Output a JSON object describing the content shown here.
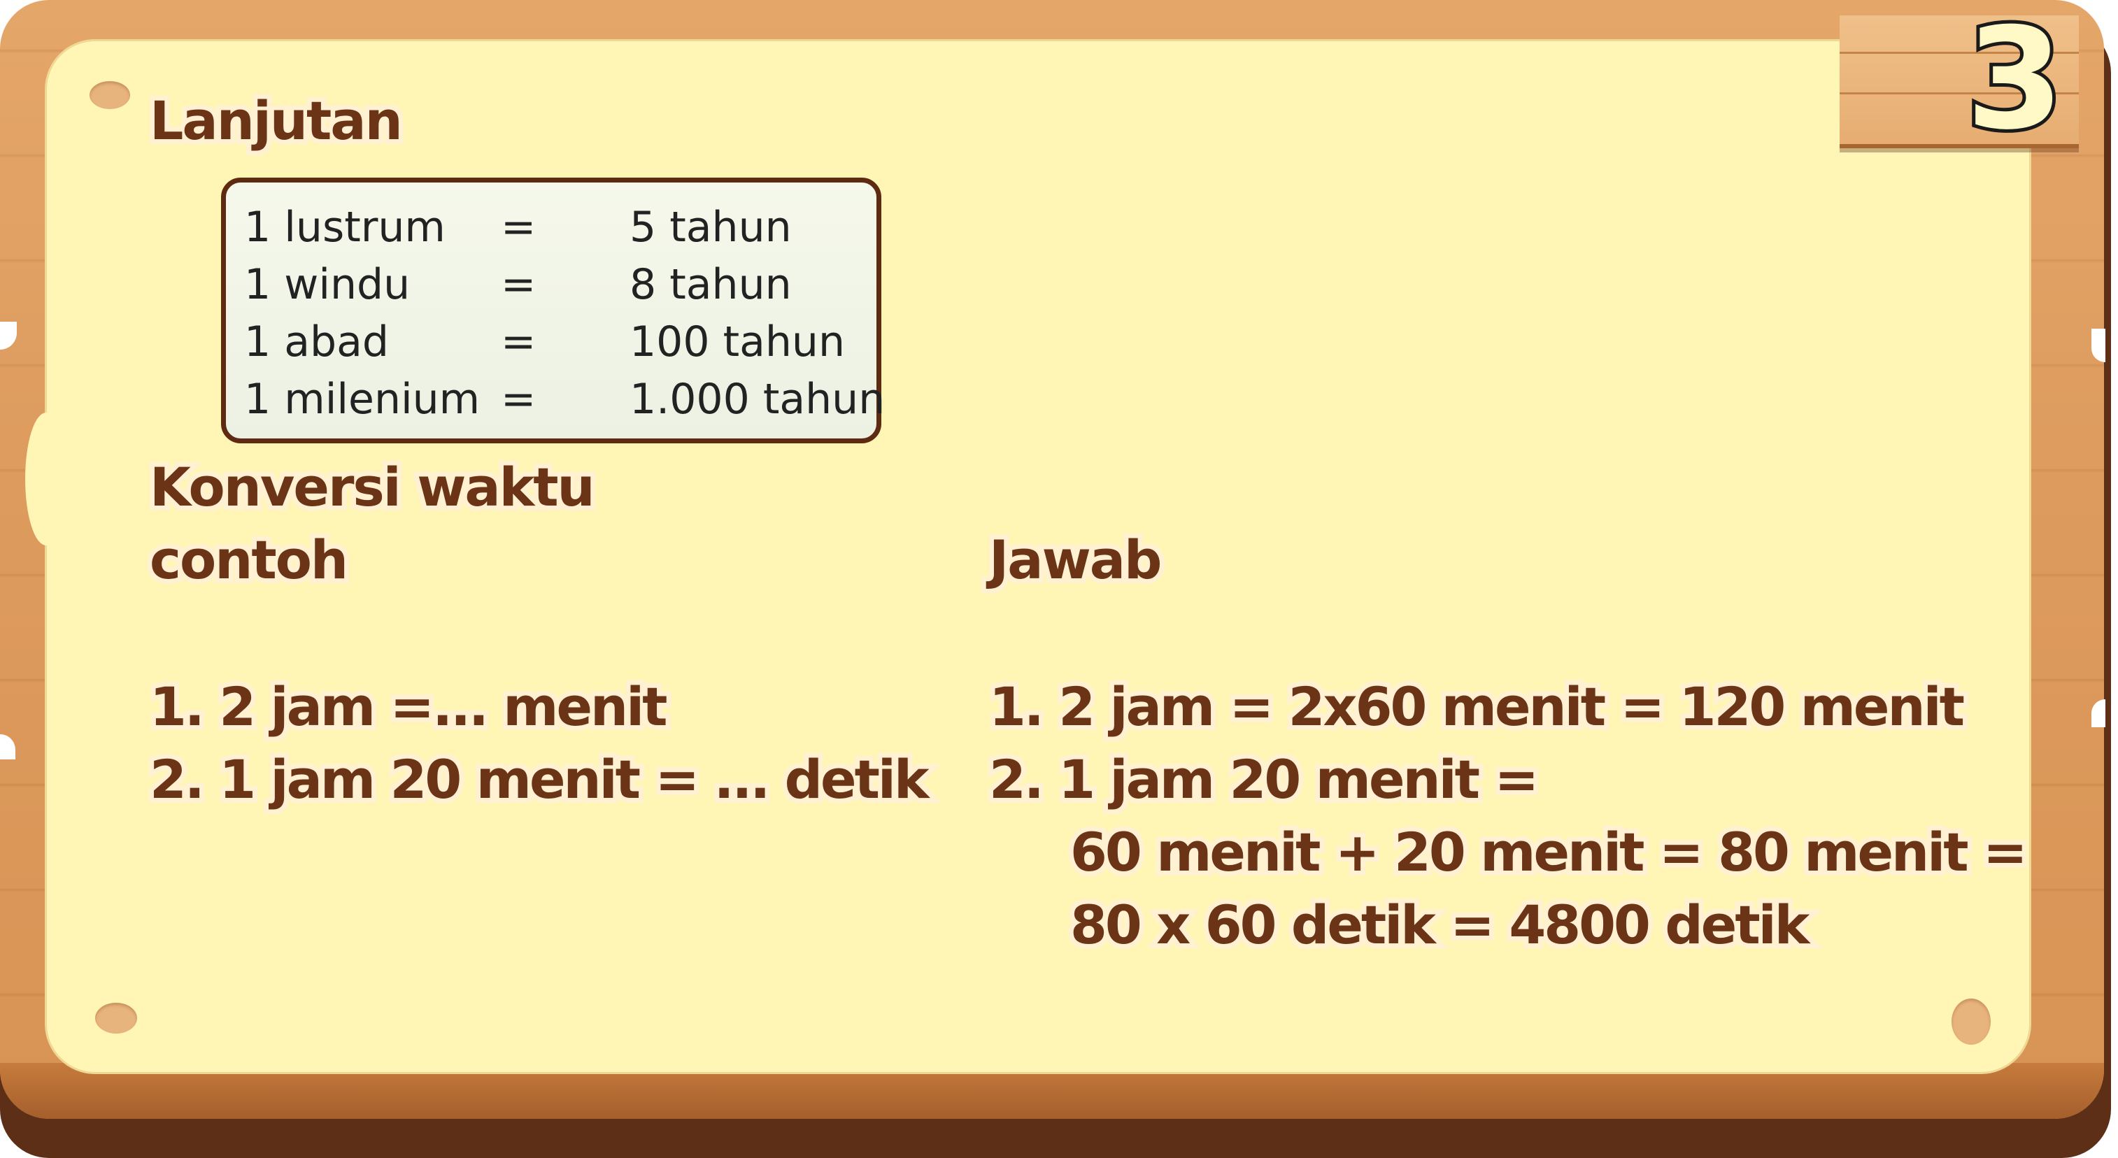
{
  "slide_number": "3",
  "section_title": "Lanjutan",
  "conversion_table": [
    {
      "unit": "1 lustrum",
      "eq": "=",
      "value": "5 tahun"
    },
    {
      "unit": "1 windu",
      "eq": "=",
      "value": "8 tahun"
    },
    {
      "unit": "1 abad",
      "eq": "=",
      "value": "100 tahun"
    },
    {
      "unit": "1 milenium",
      "eq": "=",
      "value": "1.000 tahun"
    }
  ],
  "subtitle": "Konversi waktu",
  "example_heading": "contoh",
  "answer_heading": "Jawab",
  "examples": [
    "1. 2 jam =... menit",
    "2. 1 jam 20 menit = ... detik"
  ],
  "answers": [
    "1. 2 jam = 2x60 menit = 120 menit",
    "2. 1 jam 20 menit =",
    "60 menit + 20 menit = 80 menit =",
    "80 x 60 detik = 4800 detik"
  ],
  "colors": {
    "board": "#dc9a5c",
    "board_shadow": "#5e2f17",
    "paper": "#fff5b4",
    "heading_text": "#6b3416",
    "text_outline": "#fff1d2",
    "table_border": "#5e2a12"
  }
}
